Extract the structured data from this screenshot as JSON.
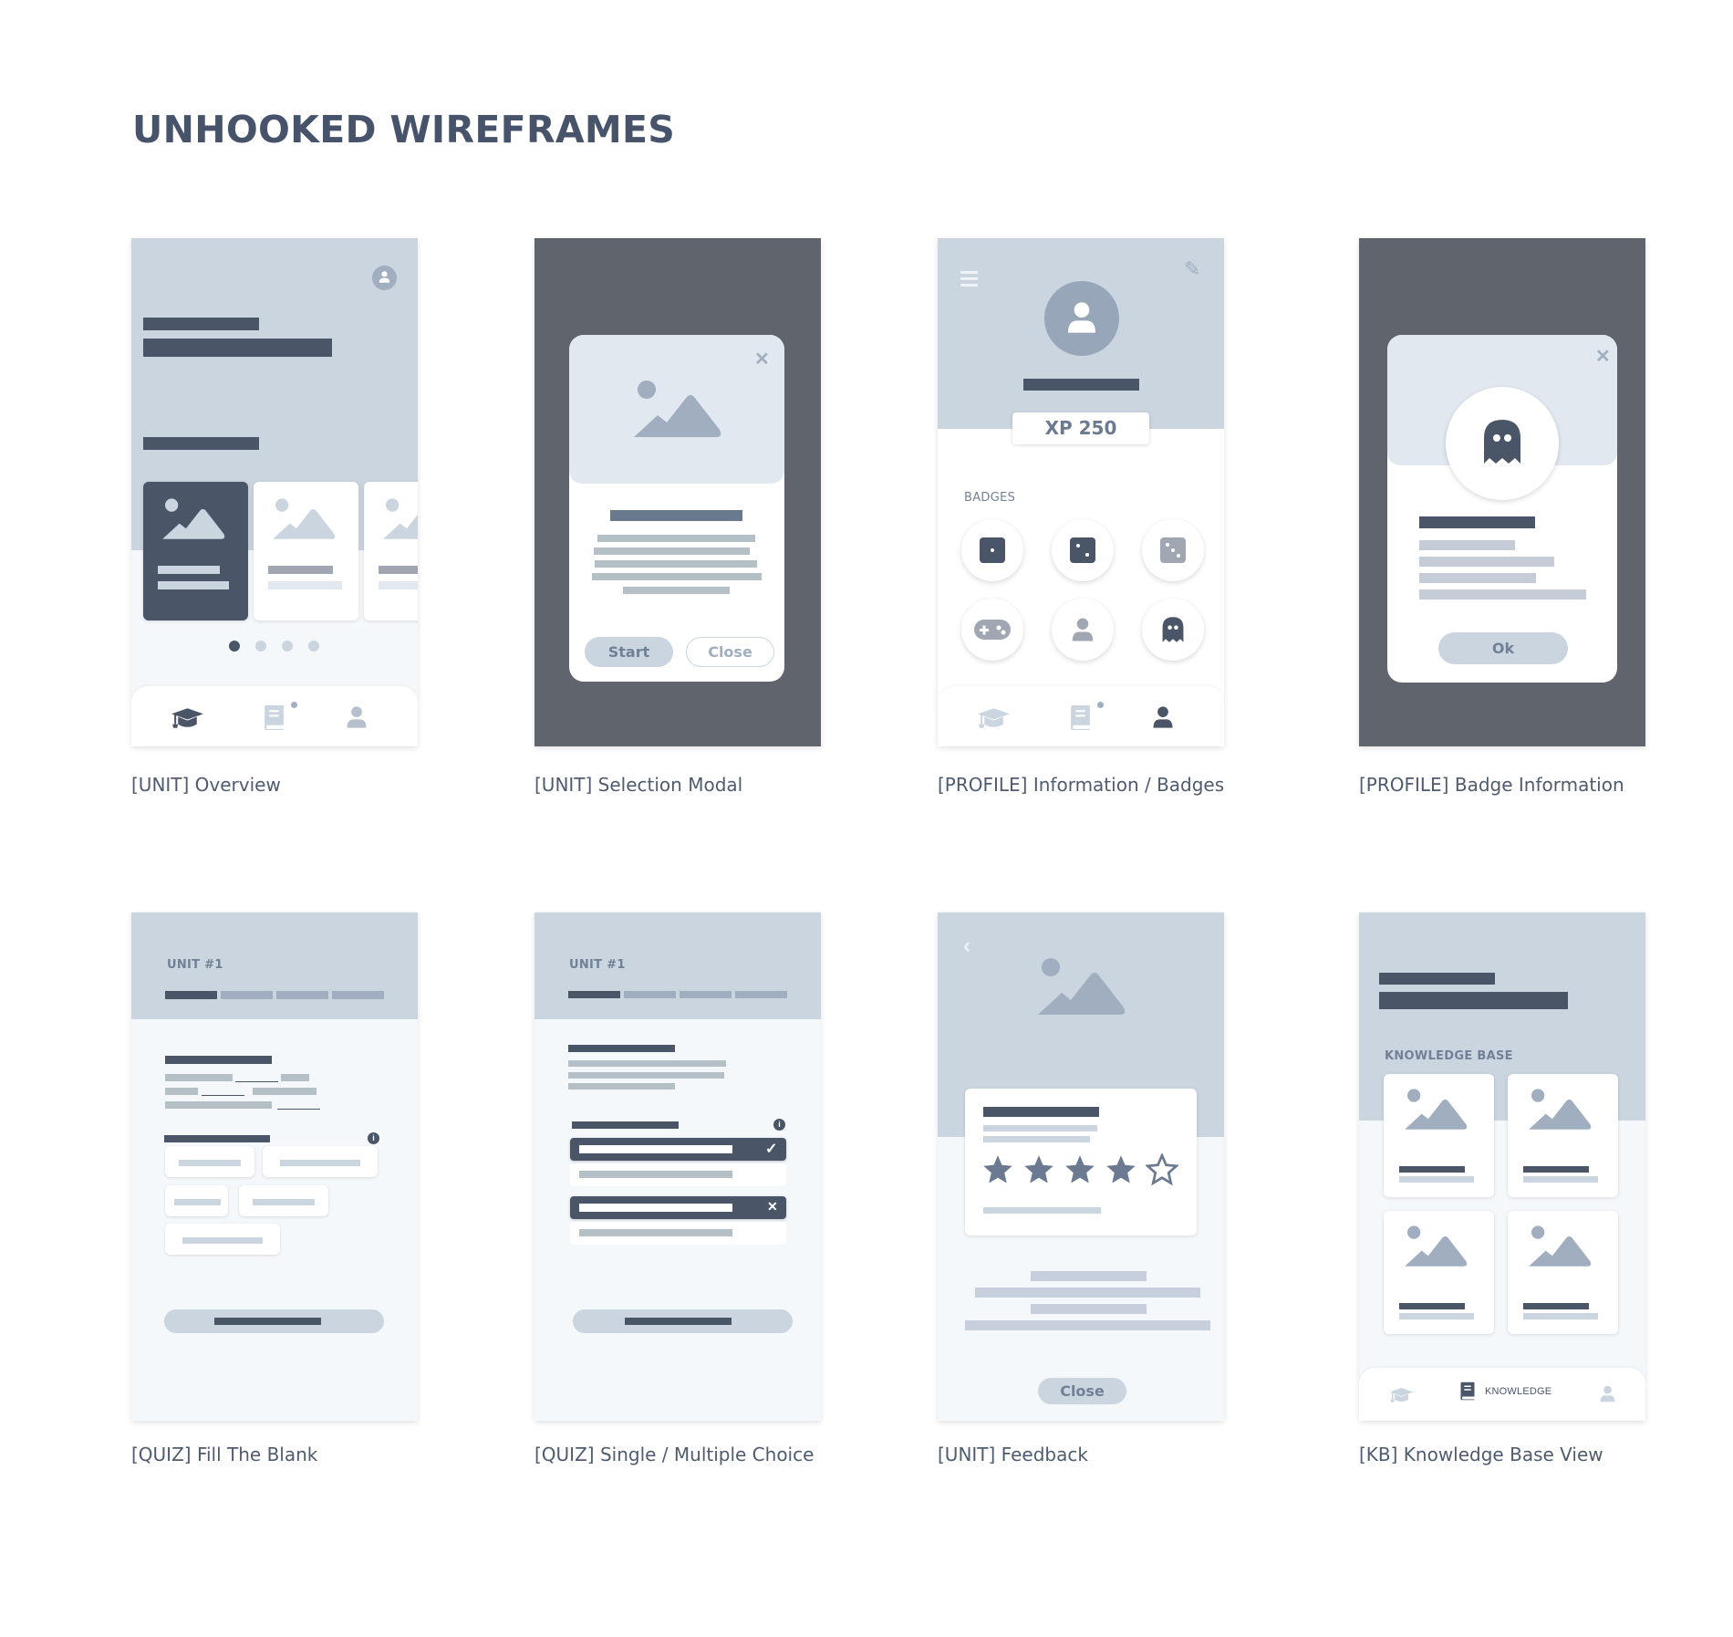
{
  "page": {
    "title": "UNHOOKED WIREFRAMES"
  },
  "colors": {
    "dark": "#4a5568",
    "mid": "#a0aec0",
    "light": "#cbd5e0",
    "overlay": "#5f646d",
    "panel": "#e2e8f0",
    "background": "#f5f8fb"
  },
  "frames": [
    {
      "caption": "[UNIT] Overview",
      "carousel": {
        "active_dot": 1,
        "dot_count": 4
      },
      "nav": {
        "items": [
          "units-icon",
          "knowledge-icon",
          "profile-icon"
        ],
        "active": "units-icon",
        "notification_on": "knowledge-icon"
      }
    },
    {
      "caption": "[UNIT] Selection Modal",
      "modal": {
        "start_label": "Start",
        "close_label": "Close"
      }
    },
    {
      "caption": "[PROFILE] Information / Badges",
      "xp_label": "XP 250",
      "badges_heading": "BADGES",
      "badges": [
        {
          "icon": "dice-one-icon",
          "earned": true
        },
        {
          "icon": "dice-two-icon",
          "earned": true
        },
        {
          "icon": "dice-three-icon",
          "earned": false
        },
        {
          "icon": "gamepad-icon",
          "earned": false
        },
        {
          "icon": "user-icon",
          "earned": false
        },
        {
          "icon": "ghost-icon",
          "earned": true
        }
      ],
      "nav": {
        "active": "profile-icon"
      }
    },
    {
      "caption": "[PROFILE] Badge Information",
      "modal": {
        "ok_label": "Ok",
        "badge_icon": "ghost-icon"
      }
    },
    {
      "caption": "[QUIZ] Fill The Blank",
      "unit_label": "UNIT #1",
      "progress": {
        "completed_steps": 1,
        "total_steps": 4
      }
    },
    {
      "caption": "[QUIZ] Single / Multiple Choice",
      "unit_label": "UNIT #1",
      "progress": {
        "completed_steps": 1,
        "total_steps": 4
      },
      "options": [
        {
          "selected": true,
          "result": "correct"
        },
        {
          "selected": false
        },
        {
          "selected": true,
          "result": "incorrect"
        },
        {
          "selected": false
        }
      ]
    },
    {
      "caption": "[UNIT] Feedback",
      "rating": {
        "value": 4,
        "max": 5
      },
      "close_label": "Close"
    },
    {
      "caption": "[KB] Knowledge Base View",
      "section_label": "KNOWLEDGE BASE",
      "nav": {
        "active_label": "KNOWLEDGE"
      }
    }
  ]
}
